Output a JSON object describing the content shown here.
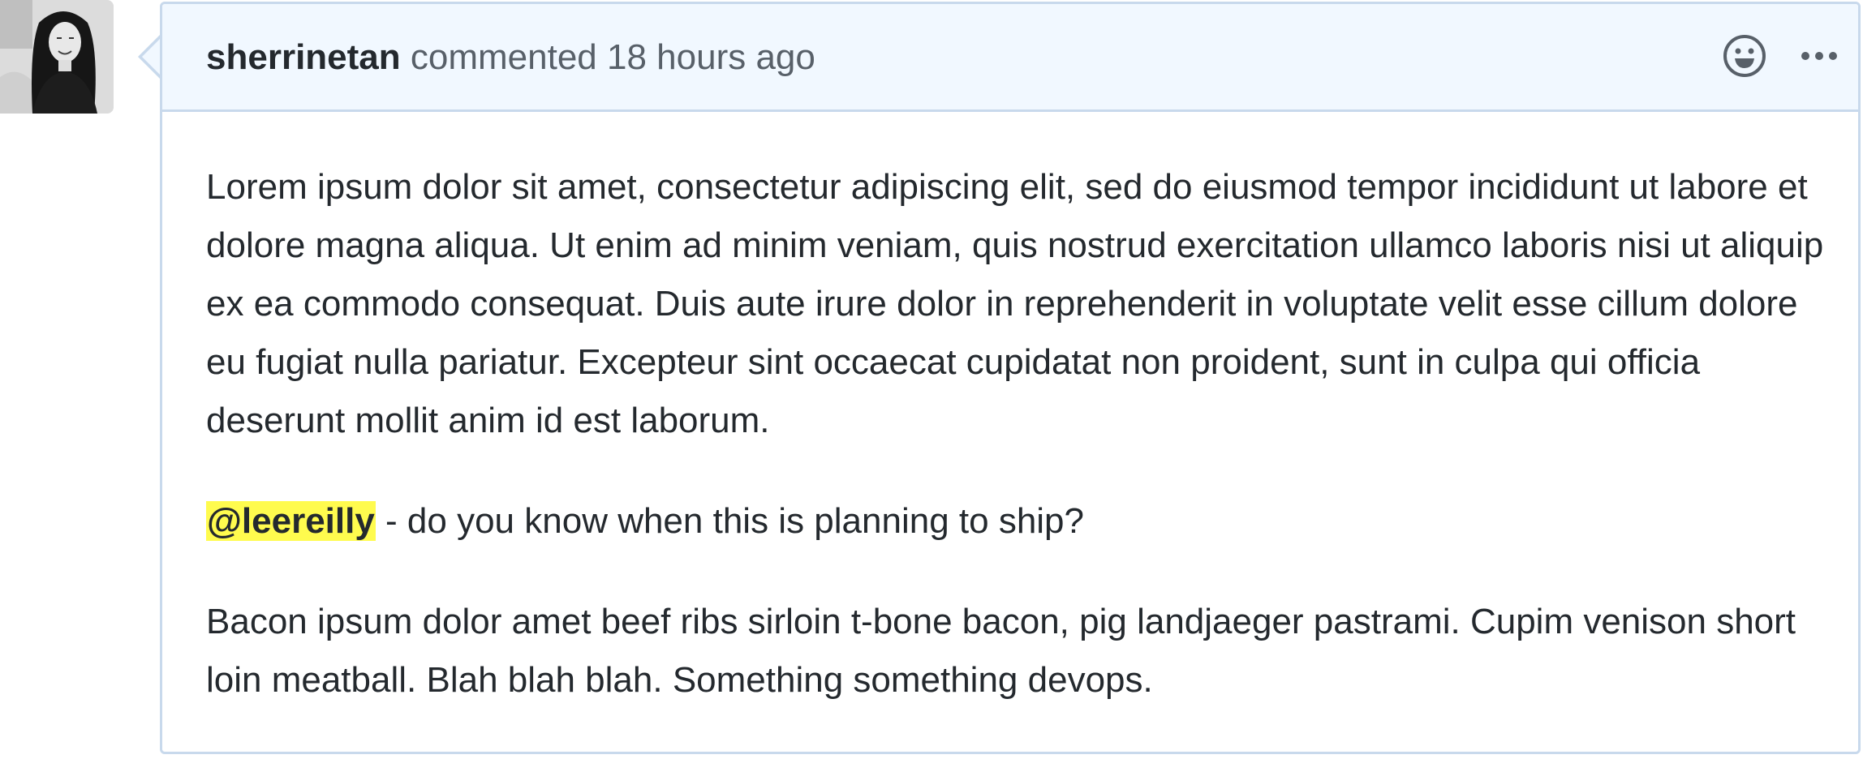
{
  "comment": {
    "author": "sherrinetan",
    "action": "commented",
    "timestamp": "18 hours ago",
    "header_icons": [
      "smiley-icon",
      "kebab-horizontal-icon"
    ],
    "paragraph1": "Lorem ipsum dolor sit amet, consectetur adipiscing elit, sed do eiusmod tempor incididunt ut labore et dolore magna aliqua. Ut enim ad minim veniam, quis nostrud exercitation ullamco laboris nisi ut aliquip ex ea commodo consequat. Duis aute irure dolor in reprehenderit in voluptate velit esse cillum dolore eu fugiat nulla pariatur. Excepteur sint occaecat cupidatat non proident, sunt in culpa qui officia deserunt mollit anim id est laborum.",
    "mention": "@leereilly",
    "mention_suffix": " - do you know when this is planning to ship?",
    "paragraph3": "Bacon ipsum dolor amet beef ribs sirloin t-bone bacon, pig landjaeger pastrami. Cupim venison short loin meatball. Blah blah blah. Something something devops."
  },
  "colors": {
    "header_bg": "#f1f8ff",
    "border": "#c8d9ec",
    "mention_highlight": "#fffb4e",
    "text": "#24292e",
    "muted_text": "#586069"
  }
}
